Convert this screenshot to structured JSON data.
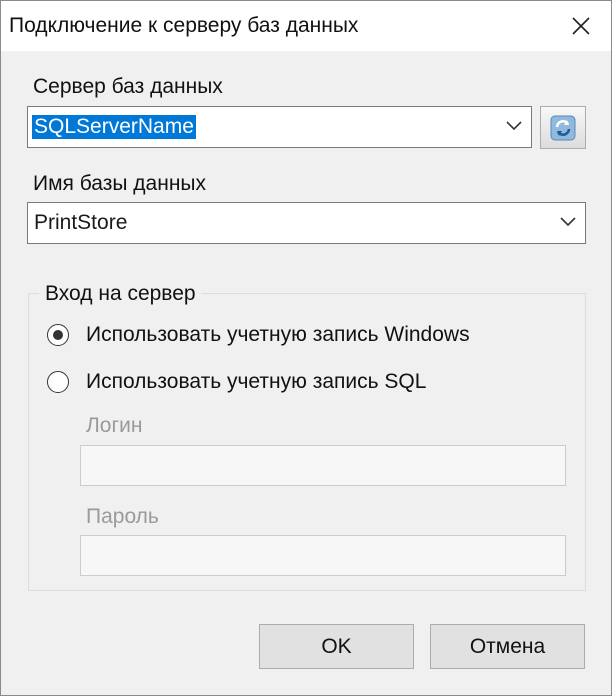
{
  "window": {
    "title": "Подключение к серверу баз данных"
  },
  "server": {
    "label": "Сервер баз данных",
    "value": "SQLServerName",
    "refresh_icon": "refresh-icon"
  },
  "database": {
    "label": "Имя базы данных",
    "value": "PrintStore"
  },
  "login_group": {
    "title": "Вход на сервер",
    "options": [
      {
        "label": "Использовать учетную запись Windows",
        "selected": true
      },
      {
        "label": "Использовать учетную запись SQL",
        "selected": false
      }
    ],
    "login_label": "Логин",
    "login_value": "",
    "password_label": "Пароль",
    "password_value": ""
  },
  "buttons": {
    "ok": "OK",
    "cancel": "Отмена"
  },
  "colors": {
    "selection": "#0078d7",
    "dialog_bg": "#f0f0f0",
    "disabled_text": "#9a9a9a"
  }
}
